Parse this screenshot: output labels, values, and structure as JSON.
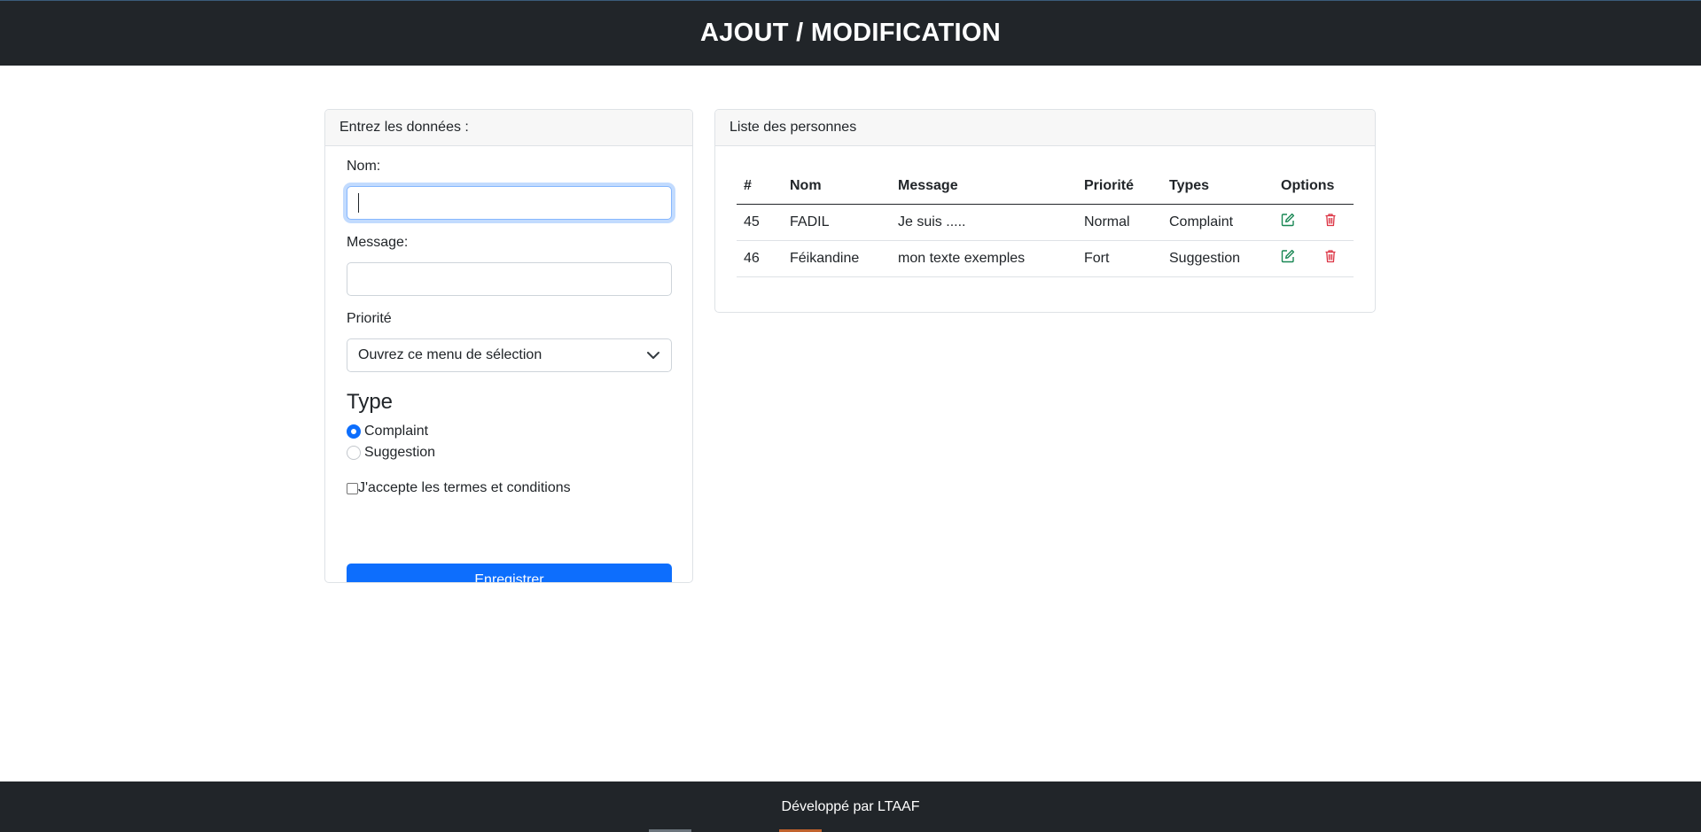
{
  "header": {
    "title": "AJOUT / MODIFICATION"
  },
  "form": {
    "header": "Entrez les données :",
    "nom_label": "Nom:",
    "nom_value": "",
    "message_label": "Message:",
    "message_value": "",
    "priorite_label": "Priorité",
    "priorite_selected": "Ouvrez ce menu de sélection",
    "type_title": "Type",
    "types": [
      {
        "label": "Complaint",
        "checked": true
      },
      {
        "label": "Suggestion",
        "checked": false
      }
    ],
    "terms_label": "J'accepte les termes et conditions",
    "terms_checked": false,
    "submit_label": "Enregistrer"
  },
  "list": {
    "header": "Liste des personnes",
    "columns": [
      "#",
      "Nom",
      "Message",
      "Priorité",
      "Types",
      "Options"
    ],
    "rows": [
      {
        "id": "45",
        "nom": "FADIL",
        "message": "Je suis .....",
        "priorite": "Normal",
        "type": "Complaint"
      },
      {
        "id": "46",
        "nom": "Féikandine",
        "message": "mon texte exemples",
        "priorite": "Fort",
        "type": "Suggestion"
      }
    ]
  },
  "footer": {
    "text": "Développé par LTAAF"
  },
  "colors": {
    "dark": "#212529",
    "primary": "#0d6efd",
    "edit_icon": "#198754",
    "delete_icon": "#dc3545"
  },
  "icons": {
    "edit": "edit-icon",
    "delete": "trash-icon",
    "select": "chevron-down-icon"
  }
}
